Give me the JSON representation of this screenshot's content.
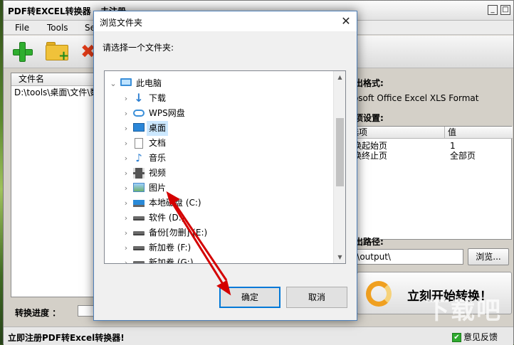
{
  "app": {
    "title": "PDF转EXCEL转换器 - 未注册",
    "menu": [
      "File",
      "Tools",
      "Se"
    ],
    "file_list": {
      "column_header": "文件名",
      "rows": [
        "D:\\tools\\桌面\\文件\\数"
      ]
    },
    "output_format_label": "输出格式:",
    "output_format_value": "Microsoft Office Excel XLS Format",
    "options_label": "选项设置:",
    "options_table": {
      "headers": [
        "选项",
        "值"
      ],
      "rows": [
        {
          "option": "转换起始页",
          "value": "1"
        },
        {
          "option": "转换终止页",
          "value": "全部页"
        }
      ]
    },
    "output_path_label": "输出路径:",
    "output_path_value": "D:\\output\\",
    "browse_label": "浏览...",
    "start_label": "立刻开始转换！",
    "progress_label": "转换进度 ：",
    "register_link": "立即注册PDF转Excel转换器!",
    "feedback_label": "意见反馈",
    "watermark": "下载吧"
  },
  "dialog": {
    "title": "浏览文件夹",
    "prompt": "请选择一个文件夹:",
    "tree": [
      {
        "label": "此电脑",
        "icon": "computer-icon",
        "level": 0,
        "expanded": true
      },
      {
        "label": "下载",
        "icon": "download-icon",
        "level": 1
      },
      {
        "label": "WPS网盘",
        "icon": "cloud-icon",
        "level": 1
      },
      {
        "label": "桌面",
        "icon": "desktop-icon",
        "level": 1,
        "selected": true
      },
      {
        "label": "文档",
        "icon": "document-icon",
        "level": 1
      },
      {
        "label": "音乐",
        "icon": "music-icon",
        "level": 1
      },
      {
        "label": "视频",
        "icon": "video-icon",
        "level": 1
      },
      {
        "label": "图片",
        "icon": "pictures-icon",
        "level": 1
      },
      {
        "label": "本地磁盘 (C:)",
        "icon": "system-drive-icon",
        "level": 1
      },
      {
        "label": "软件 (D:)",
        "icon": "drive-icon",
        "level": 1
      },
      {
        "label": "备份[勿删] (E:)",
        "icon": "drive-icon",
        "level": 1
      },
      {
        "label": "新加卷 (F:)",
        "icon": "drive-icon",
        "level": 1
      },
      {
        "label": "新加卷 (G:)",
        "icon": "drive-icon",
        "level": 1
      }
    ],
    "ok_label": "确定",
    "cancel_label": "取消"
  },
  "colors": {
    "arrow": "#d40000",
    "selection": "#cce8ff",
    "default_button_border": "#0078d7"
  }
}
